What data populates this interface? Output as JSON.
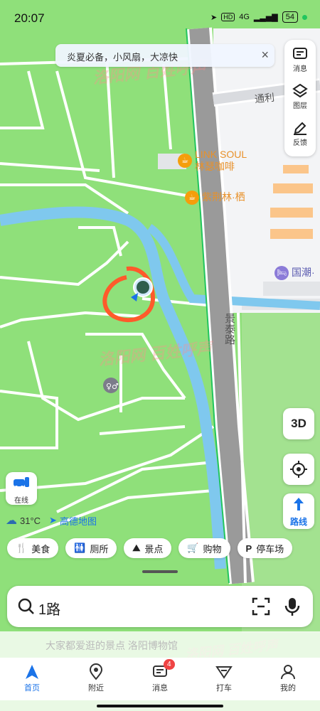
{
  "status": {
    "time": "20:07",
    "network": "4G",
    "hd": "HD",
    "battery": "54"
  },
  "tip": {
    "text": "炎夏必备，小风扇，大凉快",
    "close": "×"
  },
  "side_panel": {
    "messages": "消息",
    "layers": "图层",
    "feedback": "反馈"
  },
  "map": {
    "roads": {
      "tongli": "通利",
      "jingtai": "景泰路"
    },
    "pois": [
      {
        "name": "LINK SOUL",
        "subname": "林瑟咖啡",
        "icon": "cafe-icon"
      },
      {
        "name": "紫荆林·栖",
        "icon": "cafe-icon"
      },
      {
        "name": "国潮·",
        "icon": "bed-icon"
      }
    ],
    "watermark": "洛阳网 百姓呼声"
  },
  "controls": {
    "three_d": "3D",
    "route": "路线",
    "online": "在线"
  },
  "weather": {
    "temp": "31°C",
    "brand": "高德地图"
  },
  "chips": [
    {
      "icon": "fork-icon",
      "glyph": "🍴",
      "label": "美食"
    },
    {
      "icon": "toilet-icon",
      "glyph": "🚻",
      "label": "厕所"
    },
    {
      "icon": "scenic-icon",
      "glyph": "⛰",
      "label": "景点"
    },
    {
      "icon": "cart-icon",
      "glyph": "🛒",
      "label": "购物"
    },
    {
      "icon": "parking-icon",
      "glyph": "P",
      "label": "停车场"
    }
  ],
  "search": {
    "value": "1路"
  },
  "recommend": {
    "text": "大家都爱逛的景点 洛阳博物馆"
  },
  "tabs": [
    {
      "label": "首页"
    },
    {
      "label": "附近"
    },
    {
      "label": "消息",
      "badge": "4"
    },
    {
      "label": "打车"
    },
    {
      "label": "我的"
    }
  ],
  "colors": {
    "accent": "#1a73e8",
    "park": "#8fe07a",
    "water": "#7fc8ee",
    "road": "#9a9a9a"
  }
}
